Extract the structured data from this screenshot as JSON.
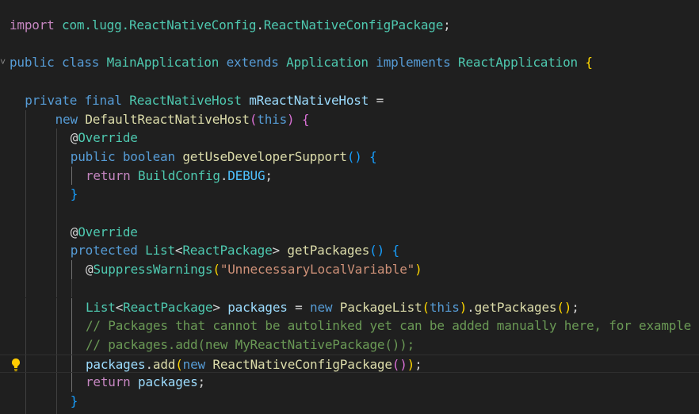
{
  "editor": {
    "lines": [
      {
        "indent": 0,
        "guides": [],
        "tokens": [
          {
            "t": "import",
            "c": "ctl"
          },
          {
            "t": " com.lugg.",
            "c": "type"
          },
          {
            "t": "ReactNativeConfig",
            "c": "type"
          },
          {
            "t": ".",
            "c": "pun"
          },
          {
            "t": "ReactNativeConfigPackage",
            "c": "type"
          },
          {
            "t": ";",
            "c": "pun"
          }
        ]
      },
      {
        "indent": 0,
        "guides": [],
        "tokens": []
      },
      {
        "indent": 0,
        "guides": [],
        "fold": true,
        "tokens": [
          {
            "t": "public",
            "c": "kw"
          },
          {
            "t": " ",
            "c": "pun"
          },
          {
            "t": "class",
            "c": "kw"
          },
          {
            "t": " ",
            "c": "pun"
          },
          {
            "t": "MainApplication",
            "c": "type"
          },
          {
            "t": " ",
            "c": "pun"
          },
          {
            "t": "extends",
            "c": "kw"
          },
          {
            "t": " ",
            "c": "pun"
          },
          {
            "t": "Application",
            "c": "type"
          },
          {
            "t": " ",
            "c": "pun"
          },
          {
            "t": "implements",
            "c": "kw"
          },
          {
            "t": " ",
            "c": "pun"
          },
          {
            "t": "ReactApplication",
            "c": "type"
          },
          {
            "t": " ",
            "c": "pun"
          },
          {
            "t": "{",
            "c": "p1"
          }
        ]
      },
      {
        "indent": 0,
        "guides": [],
        "tokens": []
      },
      {
        "indent": 1,
        "guides": [],
        "tokens": [
          {
            "t": "private",
            "c": "kw"
          },
          {
            "t": " ",
            "c": "pun"
          },
          {
            "t": "final",
            "c": "kw"
          },
          {
            "t": " ",
            "c": "pun"
          },
          {
            "t": "ReactNativeHost",
            "c": "type"
          },
          {
            "t": " ",
            "c": "pun"
          },
          {
            "t": "mReactNativeHost",
            "c": "var"
          },
          {
            "t": " =",
            "c": "pun"
          }
        ]
      },
      {
        "indent": 3,
        "guides": [
          1
        ],
        "tokens": [
          {
            "t": "new",
            "c": "kw"
          },
          {
            "t": " ",
            "c": "pun"
          },
          {
            "t": "DefaultReactNativeHost",
            "c": "fn"
          },
          {
            "t": "(",
            "c": "p2"
          },
          {
            "t": "this",
            "c": "kw"
          },
          {
            "t": ")",
            "c": "p2"
          },
          {
            "t": " ",
            "c": "pun"
          },
          {
            "t": "{",
            "c": "p2"
          }
        ]
      },
      {
        "indent": 4,
        "guides": [
          1,
          3
        ],
        "tokens": [
          {
            "t": "@",
            "c": "pun"
          },
          {
            "t": "Override",
            "c": "type"
          }
        ]
      },
      {
        "indent": 4,
        "guides": [
          1,
          3
        ],
        "tokens": [
          {
            "t": "public",
            "c": "kw"
          },
          {
            "t": " ",
            "c": "pun"
          },
          {
            "t": "boolean",
            "c": "kw"
          },
          {
            "t": " ",
            "c": "pun"
          },
          {
            "t": "getUseDeveloperSupport",
            "c": "fn"
          },
          {
            "t": "()",
            "c": "p3"
          },
          {
            "t": " ",
            "c": "pun"
          },
          {
            "t": "{",
            "c": "p3"
          }
        ]
      },
      {
        "indent": 5,
        "guides": [
          1,
          3,
          4
        ],
        "tokens": [
          {
            "t": "return",
            "c": "ctl"
          },
          {
            "t": " ",
            "c": "pun"
          },
          {
            "t": "BuildConfig",
            "c": "type"
          },
          {
            "t": ".",
            "c": "pun"
          },
          {
            "t": "DEBUG",
            "c": "con"
          },
          {
            "t": ";",
            "c": "pun"
          }
        ]
      },
      {
        "indent": 4,
        "guides": [
          1,
          3
        ],
        "tokens": [
          {
            "t": "}",
            "c": "p3"
          }
        ]
      },
      {
        "indent": 0,
        "guides": [
          1,
          3
        ],
        "tokens": []
      },
      {
        "indent": 4,
        "guides": [
          1,
          3
        ],
        "tokens": [
          {
            "t": "@",
            "c": "pun"
          },
          {
            "t": "Override",
            "c": "type"
          }
        ]
      },
      {
        "indent": 4,
        "guides": [
          1,
          3
        ],
        "tokens": [
          {
            "t": "protected",
            "c": "kw"
          },
          {
            "t": " ",
            "c": "pun"
          },
          {
            "t": "List",
            "c": "type"
          },
          {
            "t": "<",
            "c": "pun"
          },
          {
            "t": "ReactPackage",
            "c": "type"
          },
          {
            "t": ">",
            "c": "pun"
          },
          {
            "t": " ",
            "c": "pun"
          },
          {
            "t": "getPackages",
            "c": "fn"
          },
          {
            "t": "()",
            "c": "p3"
          },
          {
            "t": " ",
            "c": "pun"
          },
          {
            "t": "{",
            "c": "p3"
          }
        ]
      },
      {
        "indent": 5,
        "guides": [
          1,
          3,
          4
        ],
        "tokens": [
          {
            "t": "@",
            "c": "pun"
          },
          {
            "t": "SuppressWarnings",
            "c": "type"
          },
          {
            "t": "(",
            "c": "p1"
          },
          {
            "t": "\"UnnecessaryLocalVariable\"",
            "c": "str"
          },
          {
            "t": ")",
            "c": "p1"
          }
        ]
      },
      {
        "indent": 0,
        "guides": [
          1,
          3,
          4
        ],
        "tokens": []
      },
      {
        "indent": 5,
        "guides": [
          1,
          3,
          4
        ],
        "tokens": [
          {
            "t": "List",
            "c": "type"
          },
          {
            "t": "<",
            "c": "pun"
          },
          {
            "t": "ReactPackage",
            "c": "type"
          },
          {
            "t": ">",
            "c": "pun"
          },
          {
            "t": " ",
            "c": "pun"
          },
          {
            "t": "packages",
            "c": "var"
          },
          {
            "t": " = ",
            "c": "pun"
          },
          {
            "t": "new",
            "c": "kw"
          },
          {
            "t": " ",
            "c": "pun"
          },
          {
            "t": "PackageList",
            "c": "fn"
          },
          {
            "t": "(",
            "c": "p1"
          },
          {
            "t": "this",
            "c": "kw"
          },
          {
            "t": ")",
            "c": "p1"
          },
          {
            "t": ".",
            "c": "pun"
          },
          {
            "t": "getPackages",
            "c": "fn"
          },
          {
            "t": "()",
            "c": "p1"
          },
          {
            "t": ";",
            "c": "pun"
          }
        ]
      },
      {
        "indent": 5,
        "guides": [
          1,
          3,
          4
        ],
        "tokens": [
          {
            "t": "// Packages that cannot be autolinked yet can be added manually here, for example",
            "c": "com"
          }
        ]
      },
      {
        "indent": 5,
        "guides": [
          1,
          3,
          4
        ],
        "tokens": [
          {
            "t": "// packages.add(new MyReactNativePackage());",
            "c": "com"
          }
        ]
      },
      {
        "indent": 5,
        "guides": [
          1,
          3,
          4
        ],
        "current": true,
        "bulb": true,
        "tokens": [
          {
            "t": "packages",
            "c": "var"
          },
          {
            "t": ".",
            "c": "pun"
          },
          {
            "t": "add",
            "c": "fn"
          },
          {
            "t": "(",
            "c": "p1"
          },
          {
            "t": "new",
            "c": "kw"
          },
          {
            "t": " ",
            "c": "pun"
          },
          {
            "t": "ReactNativeConfigPackage",
            "c": "fn"
          },
          {
            "t": "()",
            "c": "p2"
          },
          {
            "t": ")",
            "c": "p1"
          },
          {
            "t": ";",
            "c": "pun"
          }
        ]
      },
      {
        "indent": 5,
        "guides": [
          1,
          3,
          4
        ],
        "tokens": [
          {
            "t": "return",
            "c": "ctl"
          },
          {
            "t": " ",
            "c": "pun"
          },
          {
            "t": "packages",
            "c": "var"
          },
          {
            "t": ";",
            "c": "pun"
          }
        ]
      },
      {
        "indent": 4,
        "guides": [
          1,
          3
        ],
        "tokens": [
          {
            "t": "}",
            "c": "p3"
          }
        ]
      },
      {
        "indent": 4,
        "guides": [
          1,
          3
        ],
        "tokens": []
      }
    ]
  },
  "colors": {
    "background": "#1f1f1f",
    "keyword": "#569cd6",
    "control": "#c586c0",
    "type": "#4ec9b0",
    "function": "#dcdcaa",
    "variable": "#9cdcfe",
    "string": "#ce9178",
    "comment": "#6a9955",
    "lightbulb": "#ffcc00"
  }
}
